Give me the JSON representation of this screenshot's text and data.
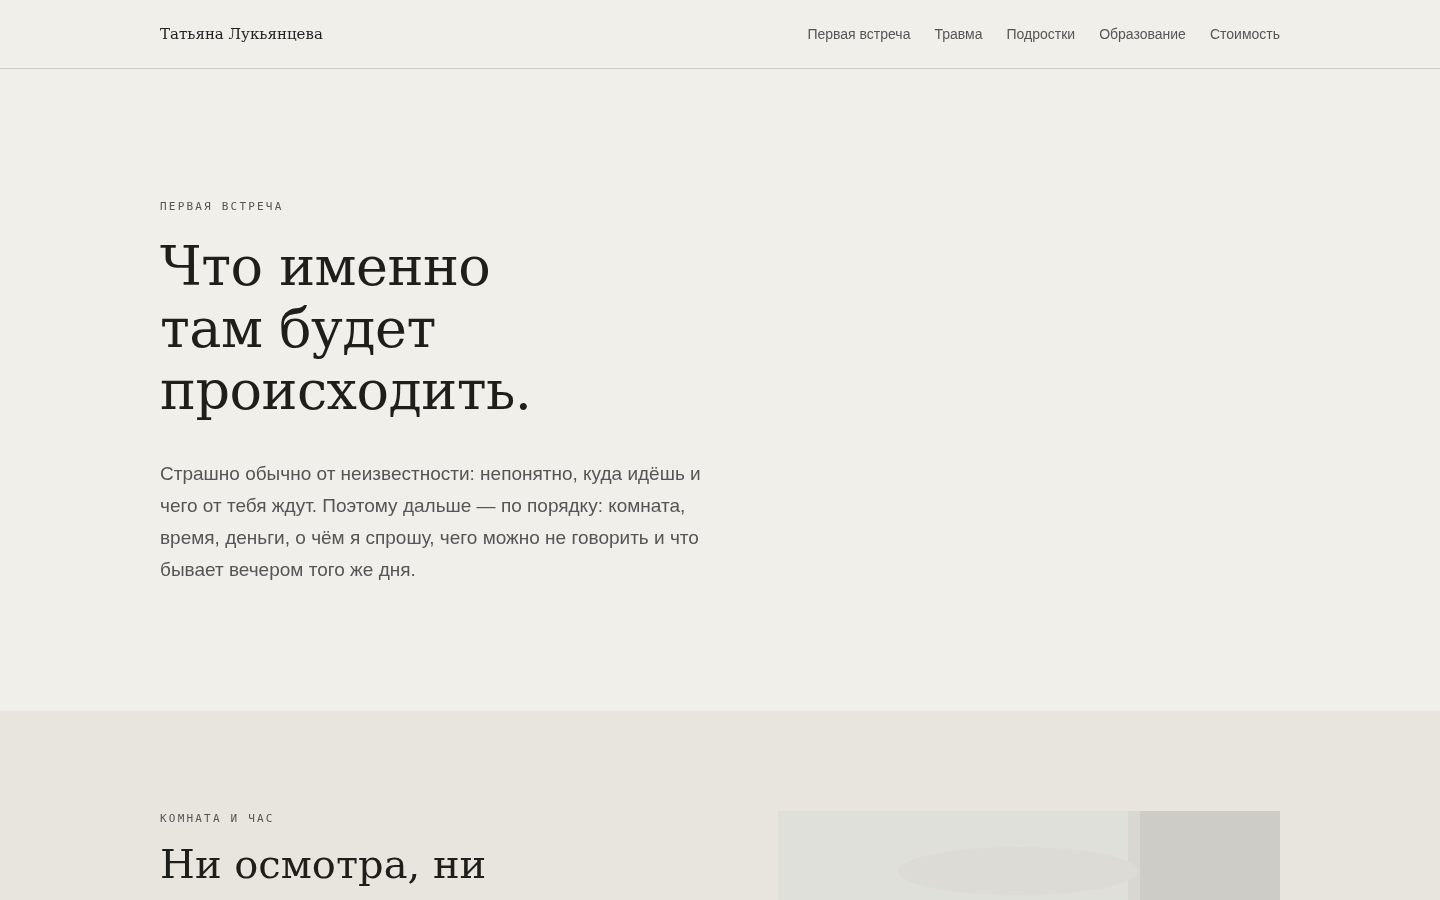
{
  "header": {
    "brand": "Татьяна Лукьянцева",
    "nav": [
      {
        "label": "Первая встреча"
      },
      {
        "label": "Травма"
      },
      {
        "label": "Подростки"
      },
      {
        "label": "Образование"
      },
      {
        "label": "Стоимость"
      }
    ]
  },
  "hero": {
    "eyebrow": "ПЕРВАЯ ВСТРЕЧА",
    "title_lines": [
      "Что именно",
      "там будет",
      "происходить."
    ],
    "lead": "Страшно обычно от неизвестности: непонятно, куда идёшь и чего от тебя ждут. Поэтому дальше — по порядку: комната, время, деньги, о чём я спрошу, чего можно не говорить и что бывает вечером того же дня."
  },
  "room": {
    "eyebrow": "КОМНАТА И ЧАС",
    "title": "Ни осмотра, ни"
  }
}
